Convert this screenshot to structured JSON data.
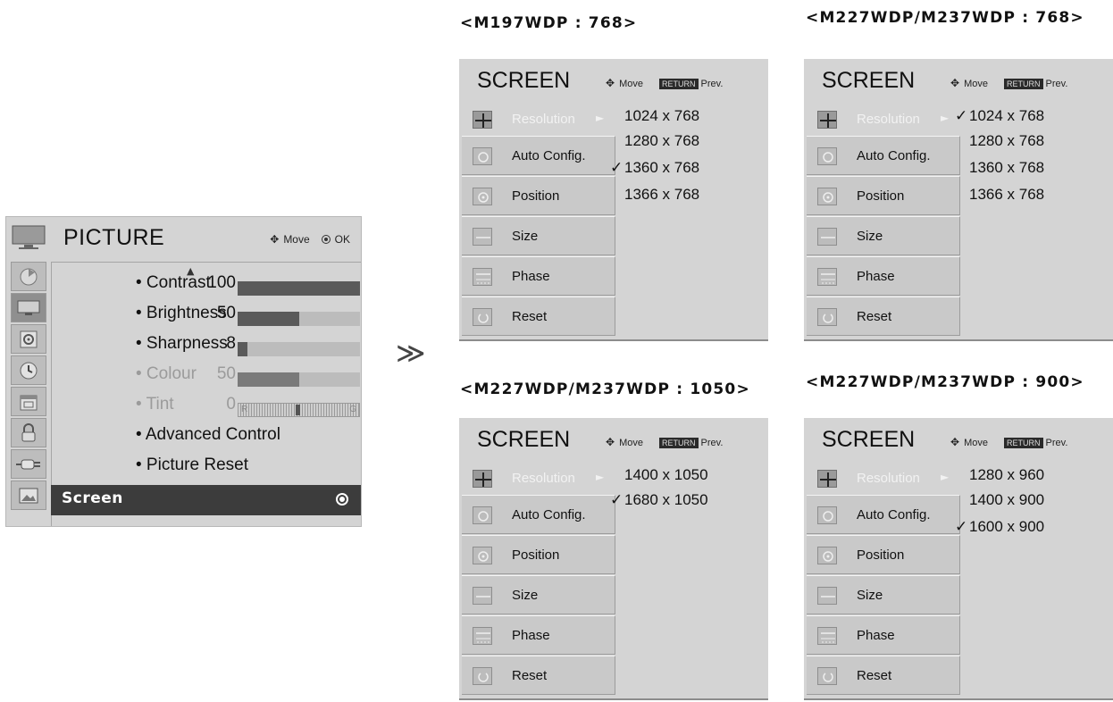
{
  "picture_menu": {
    "title": "PICTURE",
    "move_hint": "Move",
    "ok_hint": "OK",
    "items": [
      {
        "label": "• Contrast",
        "value": "100",
        "level": 100,
        "state": "normal"
      },
      {
        "label": "• Brightness",
        "value": "50",
        "level": 50,
        "state": "normal"
      },
      {
        "label": "• Sharpness",
        "value": "8",
        "level": 8,
        "state": "normal"
      },
      {
        "label": "• Colour",
        "value": "50",
        "level": 50,
        "state": "disabled"
      },
      {
        "label": "• Tint",
        "value": "0",
        "state": "disabled"
      },
      {
        "label": "• Advanced Control",
        "state": "normal"
      },
      {
        "label": "• Picture Reset",
        "state": "normal"
      }
    ],
    "tint_left": "R",
    "tint_right": "G",
    "selected_row": "Screen",
    "side_icons": [
      "picture-disc-icon",
      "tv-icon",
      "speaker-icon",
      "clock-icon",
      "calendar-icon",
      "lock-icon",
      "plug-icon",
      "photo-icon"
    ]
  },
  "arrow": "≫",
  "screen_panels": [
    {
      "caption": "<M197WDP : 768>",
      "title": "SCREEN",
      "move": "Move",
      "return": "RETURN",
      "prev": "Prev.",
      "items": [
        "Resolution",
        "Auto Config.",
        "Position",
        "Size",
        "Phase",
        "Reset"
      ],
      "options": [
        "1024 x 768",
        "1280 x 768",
        "1360 x 768",
        "1366 x 768"
      ],
      "checked": 2
    },
    {
      "caption": "<M227WDP/M237WDP : 768>",
      "title": "SCREEN",
      "move": "Move",
      "return": "RETURN",
      "prev": "Prev.",
      "items": [
        "Resolution",
        "Auto Config.",
        "Position",
        "Size",
        "Phase",
        "Reset"
      ],
      "options": [
        "1024 x 768",
        "1280 x 768",
        "1360 x 768",
        "1366 x 768"
      ],
      "checked": 0
    },
    {
      "caption": "<M227WDP/M237WDP : 1050>",
      "title": "SCREEN",
      "move": "Move",
      "return": "RETURN",
      "prev": "Prev.",
      "items": [
        "Resolution",
        "Auto Config.",
        "Position",
        "Size",
        "Phase",
        "Reset"
      ],
      "options": [
        "1400 x 1050",
        "1680 x 1050"
      ],
      "checked": 1
    },
    {
      "caption": "<M227WDP/M237WDP : 900>",
      "title": "SCREEN",
      "move": "Move",
      "return": "RETURN",
      "prev": "Prev.",
      "items": [
        "Resolution",
        "Auto Config.",
        "Position",
        "Size",
        "Phase",
        "Reset"
      ],
      "options": [
        "1280 x 960",
        "1400 x 900",
        "1600 x 900"
      ],
      "checked": 2
    }
  ]
}
